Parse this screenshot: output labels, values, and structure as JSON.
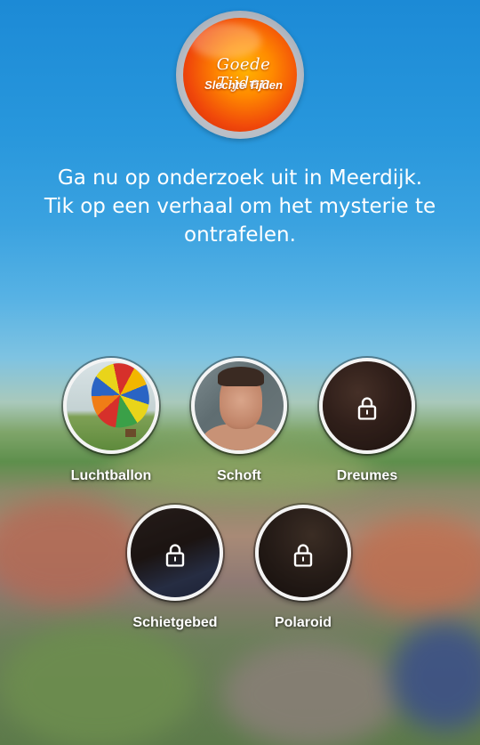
{
  "logo": {
    "line1": "Goede Tijden",
    "line2": "Slechte Tijden"
  },
  "intro": {
    "line1": "Ga nu op onderzoek uit in Meerdijk.",
    "line2": "Tik op een verhaal om het mysterie te",
    "line3": "ontrafelen."
  },
  "stories": [
    {
      "label": "Luchtballon",
      "locked": false
    },
    {
      "label": "Schoft",
      "locked": false
    },
    {
      "label": "Dreumes",
      "locked": true
    },
    {
      "label": "Schietgebed",
      "locked": true
    },
    {
      "label": "Polaroid",
      "locked": true
    }
  ],
  "icons": {
    "lock": "lock-icon"
  },
  "colors": {
    "sky_top": "#1c8ad6",
    "logo_orange": "#f0480a",
    "label_text": "#ffffff"
  }
}
